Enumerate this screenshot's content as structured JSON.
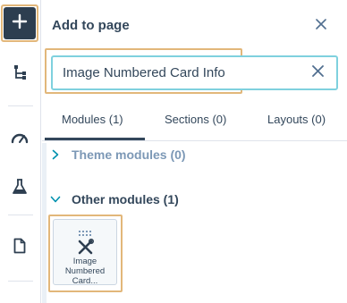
{
  "panel": {
    "title": "Add to page"
  },
  "search": {
    "value": "Image Numbered Card Info",
    "placeholder": ""
  },
  "tabs": [
    {
      "label": "Modules (1)",
      "active": true
    },
    {
      "label": "Sections (0)",
      "active": false
    },
    {
      "label": "Layouts (0)",
      "active": false
    }
  ],
  "groups": {
    "theme": {
      "label": "Theme modules (0)",
      "expanded": false
    },
    "other": {
      "label": "Other modules (1)",
      "expanded": true
    }
  },
  "module_card": {
    "line1": "Image",
    "line2": "Numbered",
    "line3": "Card..."
  },
  "rail": {
    "icons": [
      "plus-icon",
      "structure-icon",
      "gauge-icon",
      "flask-icon",
      "page-icon"
    ]
  },
  "colors": {
    "rail_active": "#2d3e50",
    "highlight": "#e2b77a",
    "search_focus": "#7fd1de",
    "text": "#33475b"
  }
}
